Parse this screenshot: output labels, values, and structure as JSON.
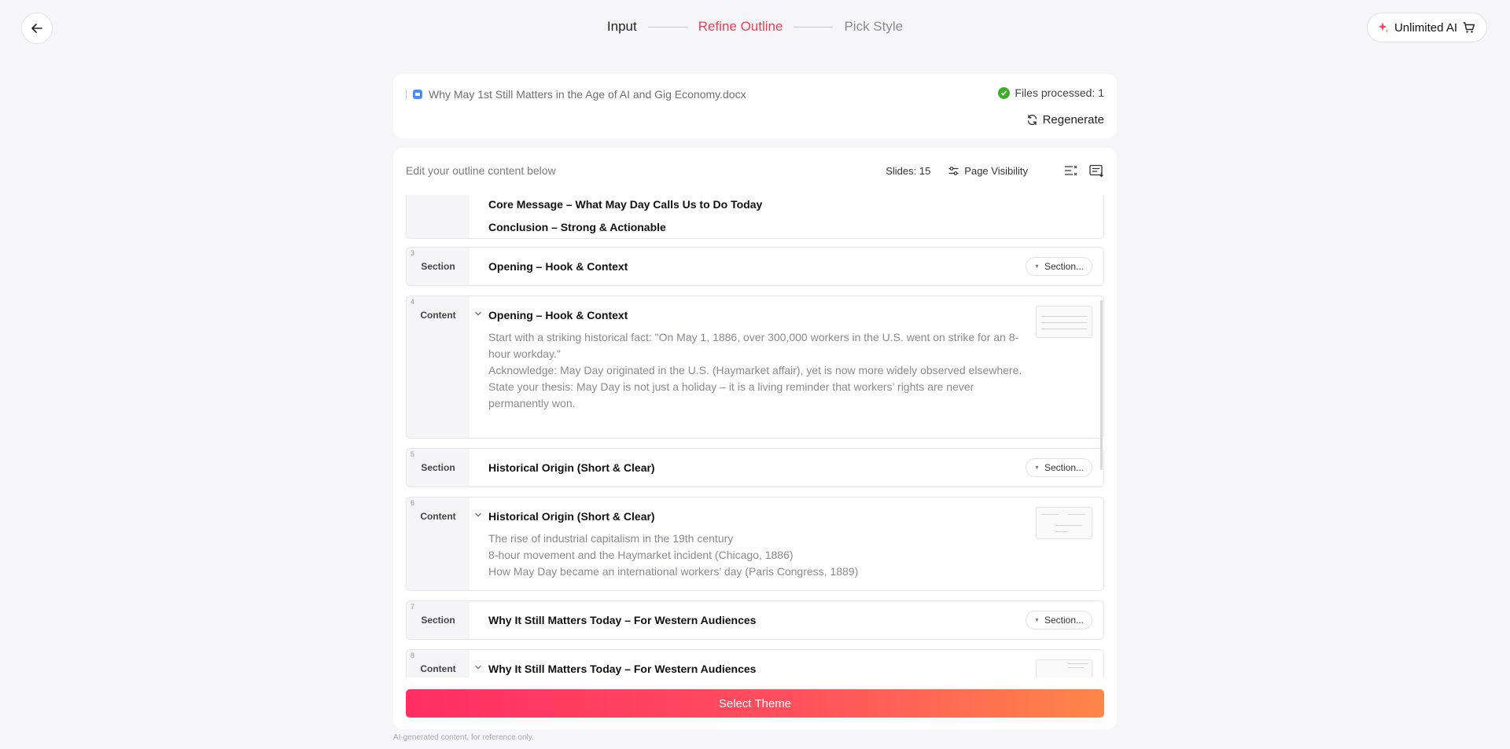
{
  "header": {
    "steps": [
      {
        "label": "Input",
        "state": "done"
      },
      {
        "label": "Refine Outline",
        "state": "active"
      },
      {
        "label": "Pick Style",
        "state": "future"
      }
    ],
    "unlimited_label": "Unlimited AI",
    "back_icon": "arrow-left-icon",
    "accent_color": "#ef3d55"
  },
  "file": {
    "name": "Why May 1st Still Matters in the Age of AI and Gig Economy.docx",
    "processed": "Files processed: 1",
    "regenerate": "Regenerate"
  },
  "outline": {
    "hint": "Edit your outline content below",
    "slides": "Slides: 15",
    "page_visibility": "Page Visibility",
    "partial_row": {
      "lines": [
        "Core Message – What May Day Calls Us to Do Today",
        "Conclusion – Strong & Actionable"
      ]
    },
    "rows": [
      {
        "num": "3",
        "type": "Section",
        "title": "Opening – Hook & Context",
        "pill": "Section..."
      },
      {
        "num": "4",
        "type": "Content",
        "title": "Opening – Hook & Context",
        "body": [
          "Start with a striking historical fact: \"On May 1, 1886, over 300,000 workers in the U.S. went on strike for an 8-hour workday.\"",
          "Acknowledge: May Day originated in the U.S. (Haymarket affair), yet is now more widely observed elsewhere.",
          "State your thesis: May Day is not just a holiday – it is a living reminder that workers’ rights are never permanently won."
        ]
      },
      {
        "num": "5",
        "type": "Section",
        "title": "Historical Origin (Short & Clear)",
        "pill": "Section..."
      },
      {
        "num": "6",
        "type": "Content",
        "title": "Historical Origin (Short & Clear)",
        "body": [
          "The rise of industrial capitalism in the 19th century",
          "8-hour movement and the Haymarket incident (Chicago, 1886)",
          "How May Day became an international workers’ day (Paris Congress, 1889)"
        ]
      },
      {
        "num": "7",
        "type": "Section",
        "title": "Why It Still Matters Today – For Western Audiences",
        "pill": "Section..."
      },
      {
        "num": "8",
        "type": "Content",
        "title": "Why It Still Matters Today – For Western Audiences"
      }
    ]
  },
  "actions": {
    "select_theme": "Select Theme"
  },
  "footer": {
    "note": "AI-generated content, for reference only."
  }
}
